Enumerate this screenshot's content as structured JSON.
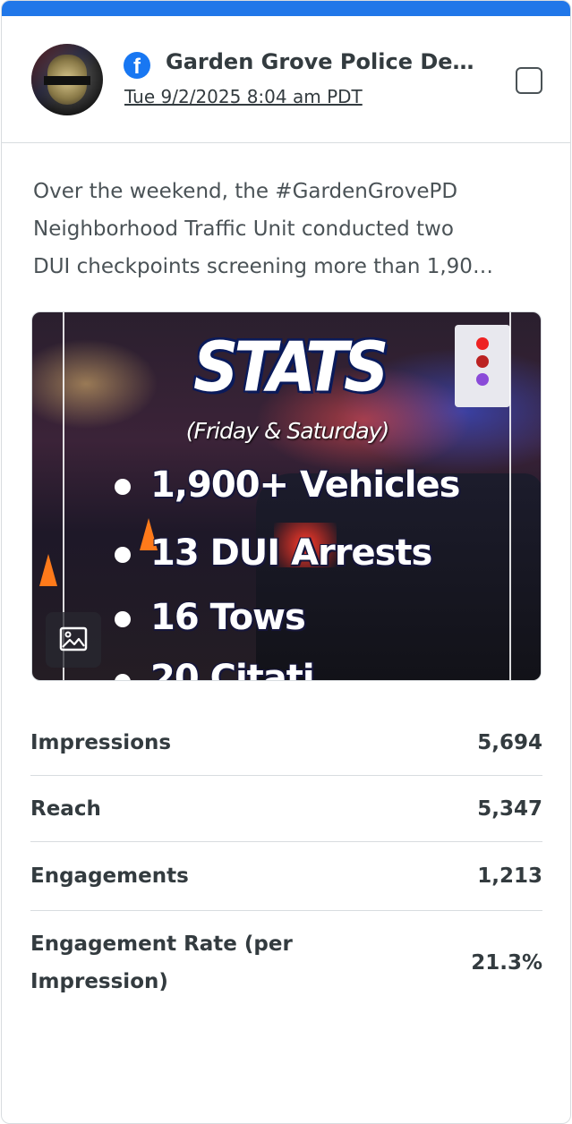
{
  "post": {
    "page_name": "Garden Grove Police De…",
    "timestamp": "Tue 9/2/2025 8:04 am PDT",
    "platform_icon": "facebook-icon",
    "caption_lines": [
      "Over the weekend, the #GardenGrovePD",
      "Neighborhood Traffic Unit conducted two",
      "DUI checkpoints screening more than 1,90…"
    ]
  },
  "media": {
    "title": "STATS",
    "subtitle": "(Friday & Saturday)",
    "lines": [
      "1,900+ Vehicles",
      "13 DUI Arrests",
      "16 Tows",
      "20 Citati"
    ],
    "media_type_icon": "image-icon"
  },
  "metrics": [
    {
      "label": "Impressions",
      "value": "5,694"
    },
    {
      "label": "Reach",
      "value": "5,347"
    },
    {
      "label": "Engagements",
      "value": "1,213"
    },
    {
      "label": "Engagement Rate (per Impression)",
      "value": "21.3%"
    }
  ],
  "colors": {
    "accent": "#2077e9",
    "facebook": "#1877f2",
    "text": "#333b3f",
    "divider": "#d8dcdf"
  }
}
